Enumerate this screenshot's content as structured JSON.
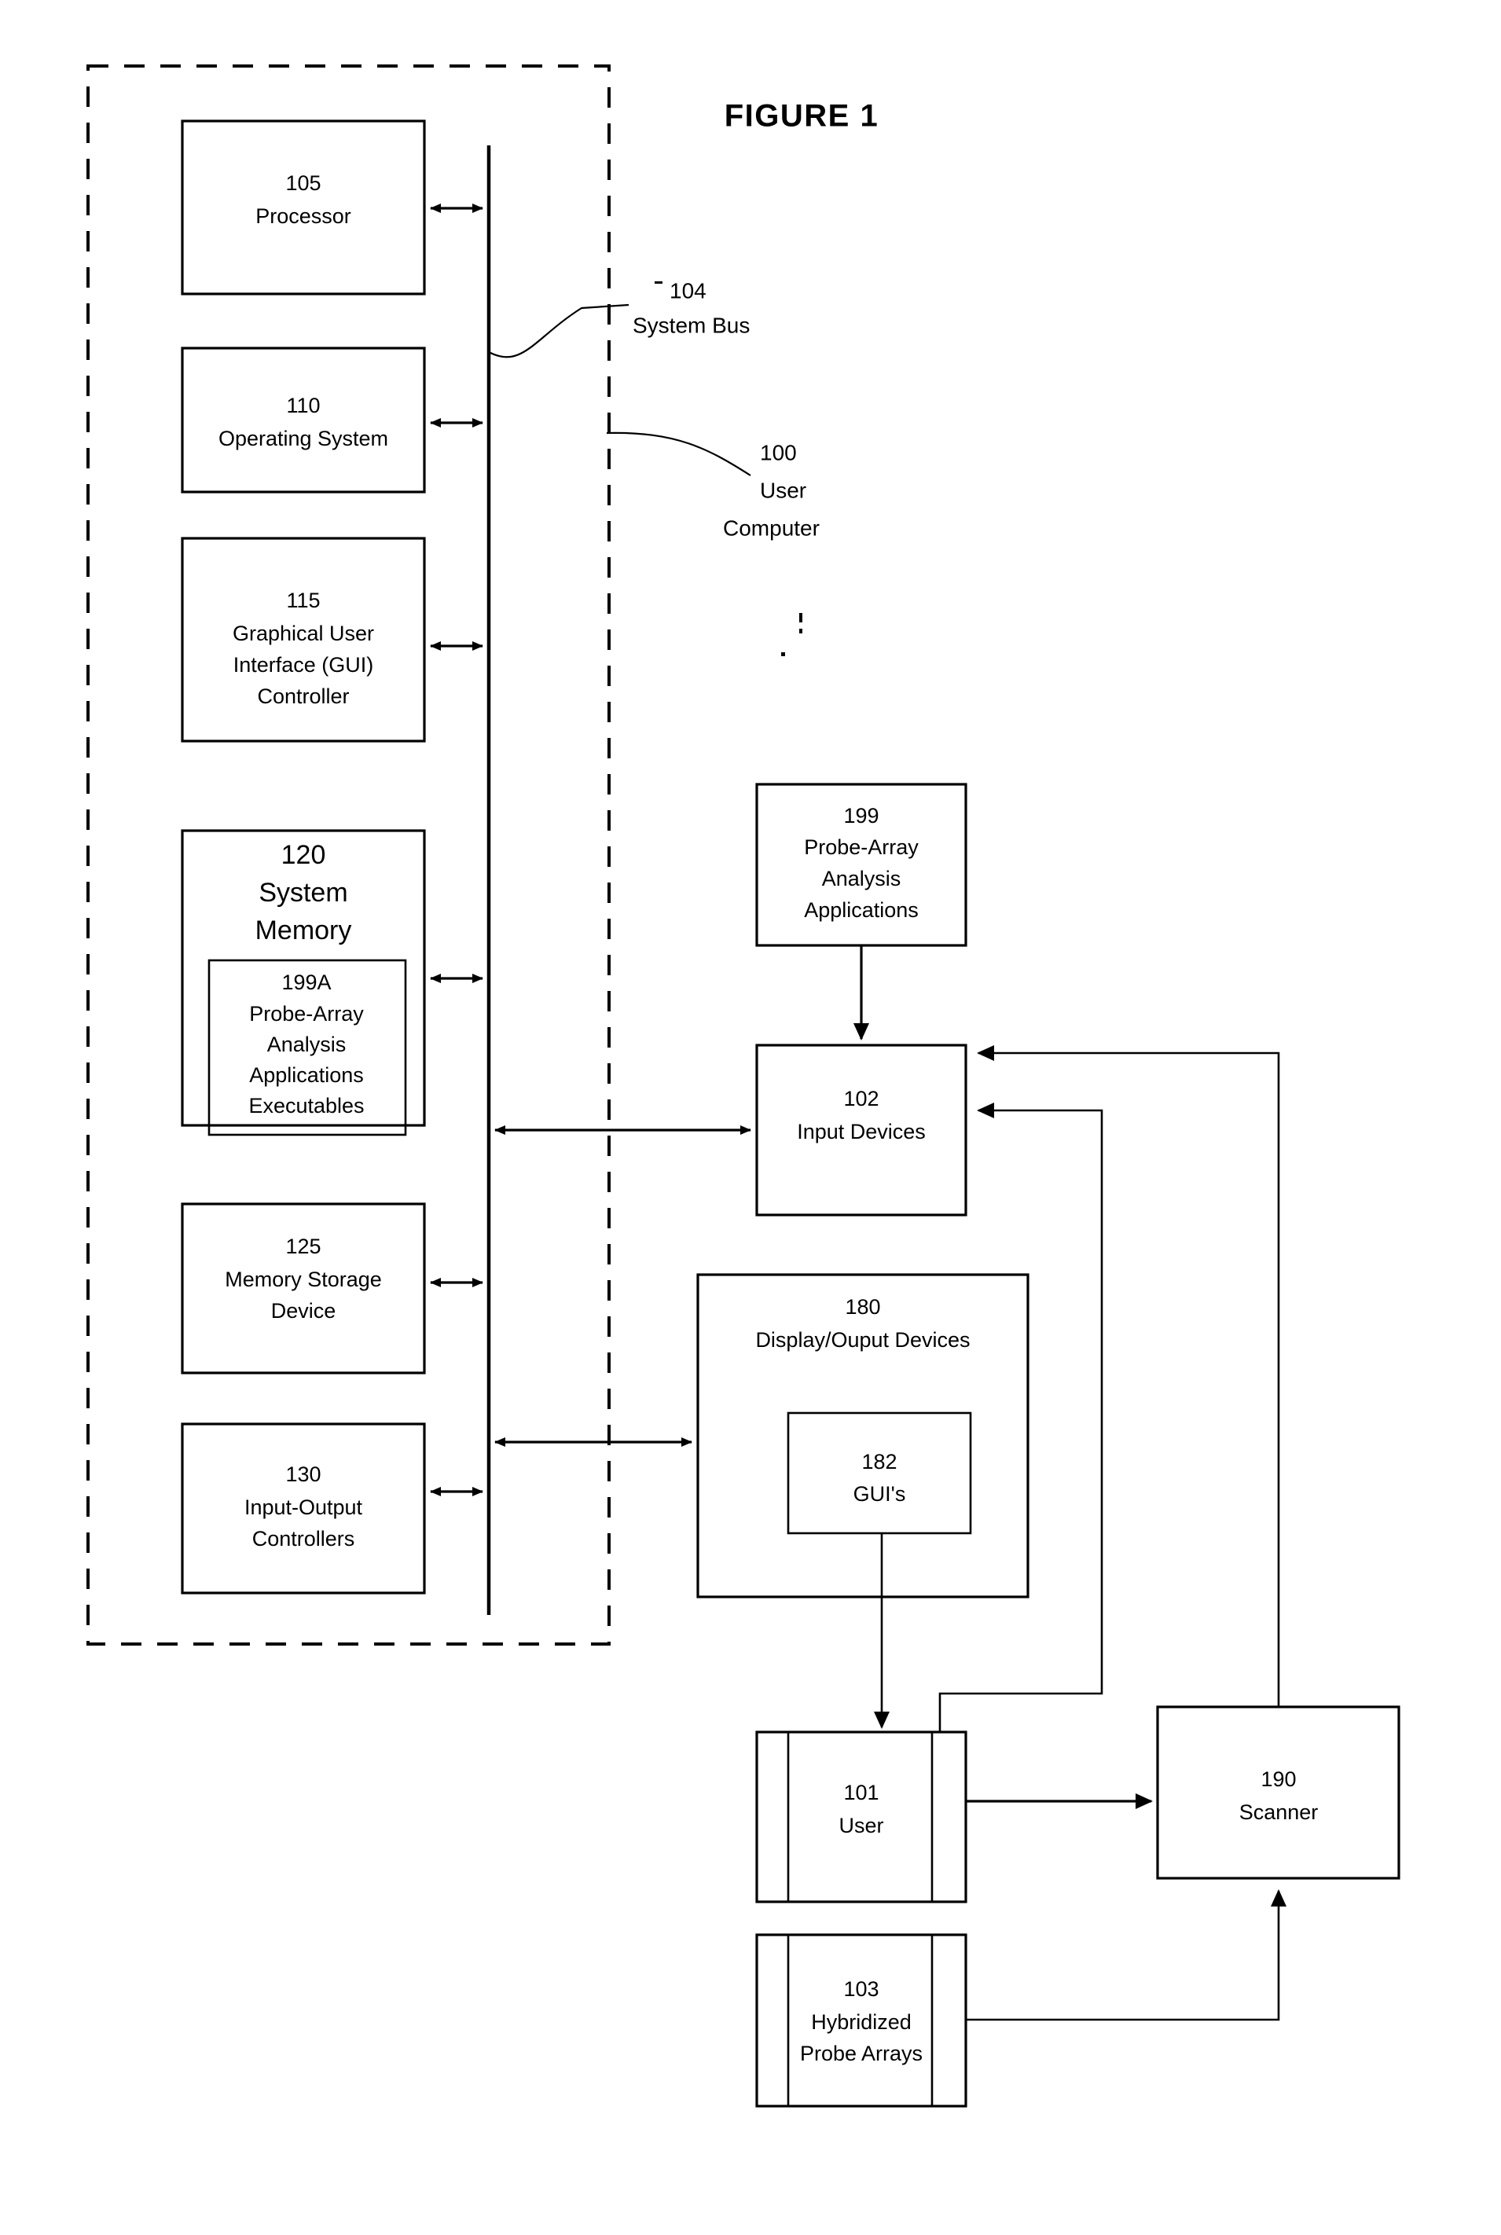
{
  "figure": {
    "title": "FIGURE 1",
    "typo_note_display_output": "Display/Ouput Devices"
  },
  "annotations": [
    {
      "id": "bus",
      "ref": "104",
      "label": "System Bus"
    },
    {
      "id": "enclosure",
      "ref": "100",
      "label_line1": "User",
      "label_line2": "Computer"
    }
  ],
  "blocks": {
    "processor": {
      "ref": "105",
      "lines": [
        "Processor"
      ]
    },
    "operating_system": {
      "ref": "110",
      "lines": [
        "Operating System"
      ]
    },
    "gui_controller": {
      "ref": "115",
      "lines": [
        "Graphical User",
        "Interface (GUI)",
        "Controller"
      ]
    },
    "system_memory": {
      "ref": "120",
      "lines": [
        "System",
        "Memory"
      ]
    },
    "apps_executables": {
      "ref": "199A",
      "lines": [
        "Probe-Array",
        "Analysis",
        "Applications",
        "Executables"
      ]
    },
    "memory_storage": {
      "ref": "125",
      "lines": [
        "Memory Storage",
        "Device"
      ]
    },
    "io_controllers": {
      "ref": "130",
      "lines": [
        "Input-Output",
        "Controllers"
      ]
    },
    "analysis_apps": {
      "ref": "199",
      "lines": [
        "Probe-Array",
        "Analysis",
        "Applications"
      ]
    },
    "input_devices": {
      "ref": "102",
      "lines": [
        "Input Devices"
      ]
    },
    "display_outputs": {
      "ref": "180",
      "lines": [
        "Display/Ouput Devices"
      ]
    },
    "guis": {
      "ref": "182",
      "lines": [
        "GUI's"
      ]
    },
    "user": {
      "ref": "101",
      "lines": [
        "User"
      ]
    },
    "scanner": {
      "ref": "190",
      "lines": [
        "Scanner"
      ]
    },
    "hybridized_arrays": {
      "ref": "103",
      "lines": [
        "Hybridized",
        "Probe Arrays"
      ]
    }
  },
  "colors": {
    "ink": "#000000",
    "paper": "#ffffff"
  }
}
